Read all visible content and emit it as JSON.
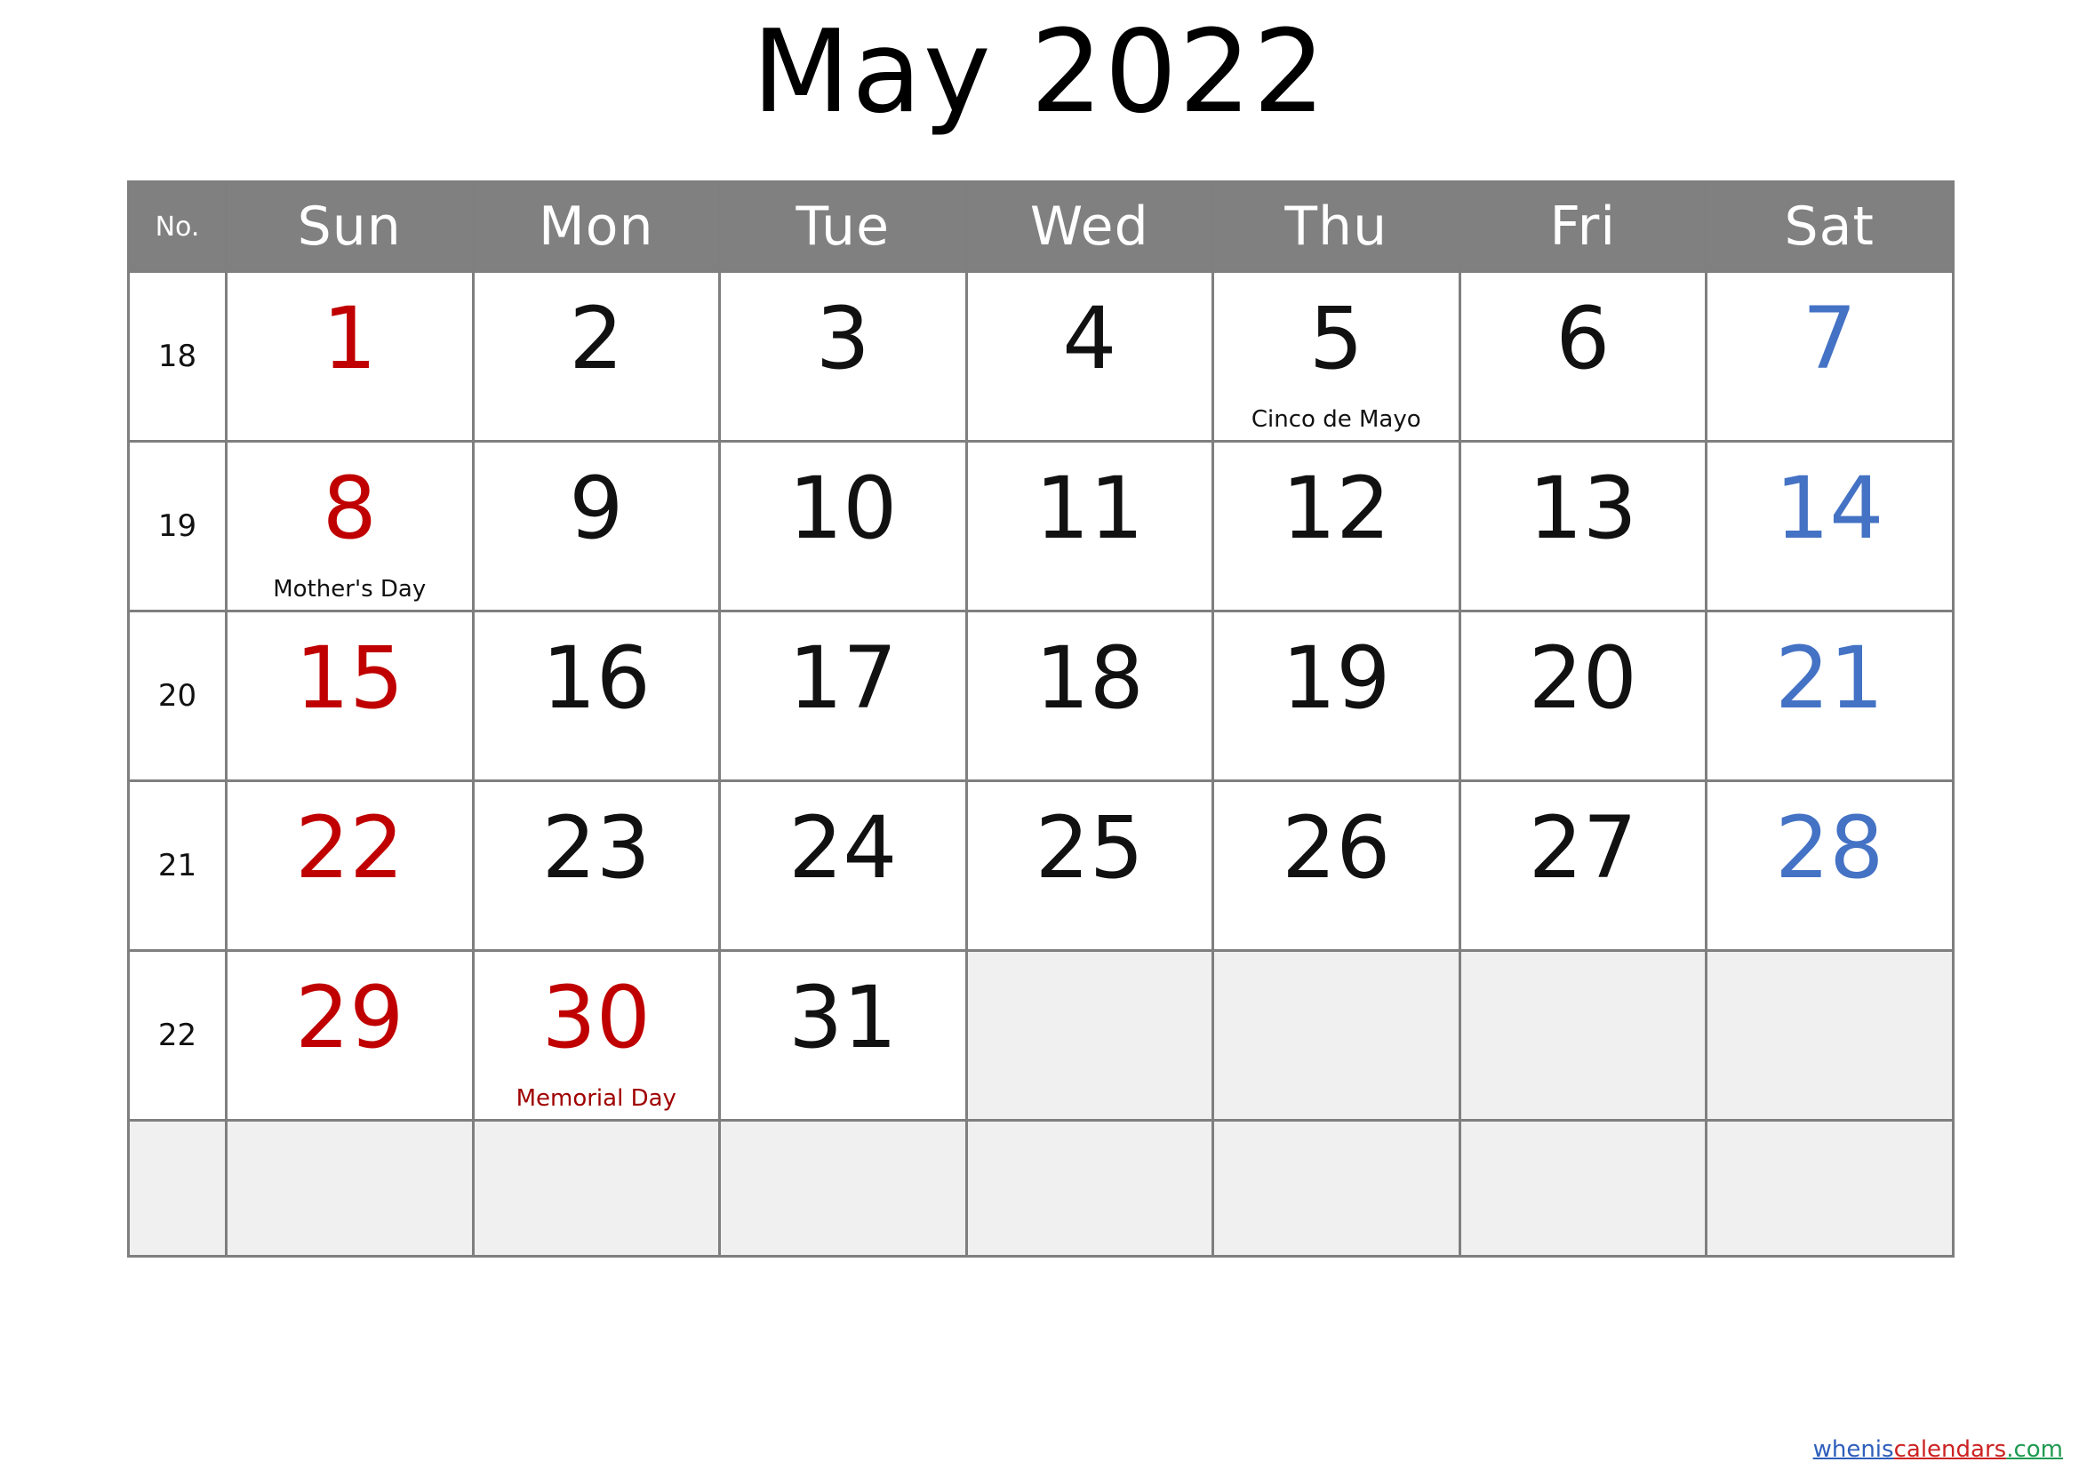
{
  "title": "May 2022",
  "colors": {
    "header_bg": "#808080",
    "header_text": "#ffffff",
    "grid_line": "#7f7f7f",
    "sunday": "#c00000",
    "saturday": "#4472c4",
    "weekday": "#111111",
    "empty_cell": "#f0f0f0",
    "watermark_blue": "#2e5fbb",
    "watermark_red": "#cc2222",
    "watermark_green": "#1f9a52"
  },
  "header": {
    "week_number_label": "No.",
    "days": [
      "Sun",
      "Mon",
      "Tue",
      "Wed",
      "Thu",
      "Fri",
      "Sat"
    ]
  },
  "weeks": [
    {
      "week_number": "18",
      "days": [
        {
          "date": "1",
          "type": "sun",
          "holiday": ""
        },
        {
          "date": "2",
          "type": "weekday",
          "holiday": ""
        },
        {
          "date": "3",
          "type": "weekday",
          "holiday": ""
        },
        {
          "date": "4",
          "type": "weekday",
          "holiday": ""
        },
        {
          "date": "5",
          "type": "weekday",
          "holiday": "Cinco de Mayo"
        },
        {
          "date": "6",
          "type": "weekday",
          "holiday": ""
        },
        {
          "date": "7",
          "type": "sat",
          "holiday": ""
        }
      ]
    },
    {
      "week_number": "19",
      "days": [
        {
          "date": "8",
          "type": "sun",
          "holiday": "Mother's Day"
        },
        {
          "date": "9",
          "type": "weekday",
          "holiday": ""
        },
        {
          "date": "10",
          "type": "weekday",
          "holiday": ""
        },
        {
          "date": "11",
          "type": "weekday",
          "holiday": ""
        },
        {
          "date": "12",
          "type": "weekday",
          "holiday": ""
        },
        {
          "date": "13",
          "type": "weekday",
          "holiday": ""
        },
        {
          "date": "14",
          "type": "sat",
          "holiday": ""
        }
      ]
    },
    {
      "week_number": "20",
      "days": [
        {
          "date": "15",
          "type": "sun",
          "holiday": ""
        },
        {
          "date": "16",
          "type": "weekday",
          "holiday": ""
        },
        {
          "date": "17",
          "type": "weekday",
          "holiday": ""
        },
        {
          "date": "18",
          "type": "weekday",
          "holiday": ""
        },
        {
          "date": "19",
          "type": "weekday",
          "holiday": ""
        },
        {
          "date": "20",
          "type": "weekday",
          "holiday": ""
        },
        {
          "date": "21",
          "type": "sat",
          "holiday": ""
        }
      ]
    },
    {
      "week_number": "21",
      "days": [
        {
          "date": "22",
          "type": "sun",
          "holiday": ""
        },
        {
          "date": "23",
          "type": "weekday",
          "holiday": ""
        },
        {
          "date": "24",
          "type": "weekday",
          "holiday": ""
        },
        {
          "date": "25",
          "type": "weekday",
          "holiday": ""
        },
        {
          "date": "26",
          "type": "weekday",
          "holiday": ""
        },
        {
          "date": "27",
          "type": "weekday",
          "holiday": ""
        },
        {
          "date": "28",
          "type": "sat",
          "holiday": ""
        }
      ]
    },
    {
      "week_number": "22",
      "days": [
        {
          "date": "29",
          "type": "sun",
          "holiday": ""
        },
        {
          "date": "30",
          "type": "holiday",
          "holiday": "Memorial Day"
        },
        {
          "date": "31",
          "type": "weekday",
          "holiday": ""
        },
        {
          "date": "",
          "type": "empty",
          "holiday": ""
        },
        {
          "date": "",
          "type": "empty",
          "holiday": ""
        },
        {
          "date": "",
          "type": "empty",
          "holiday": ""
        },
        {
          "date": "",
          "type": "empty",
          "holiday": ""
        }
      ]
    },
    {
      "week_number": "",
      "trailing": true,
      "days": [
        {
          "date": "",
          "type": "empty",
          "holiday": ""
        },
        {
          "date": "",
          "type": "empty",
          "holiday": ""
        },
        {
          "date": "",
          "type": "empty",
          "holiday": ""
        },
        {
          "date": "",
          "type": "empty",
          "holiday": ""
        },
        {
          "date": "",
          "type": "empty",
          "holiday": ""
        },
        {
          "date": "",
          "type": "empty",
          "holiday": ""
        },
        {
          "date": "",
          "type": "empty",
          "holiday": ""
        }
      ]
    }
  ],
  "watermark": {
    "part1": "whenis",
    "part2": "calendars",
    "part3": ".com"
  }
}
